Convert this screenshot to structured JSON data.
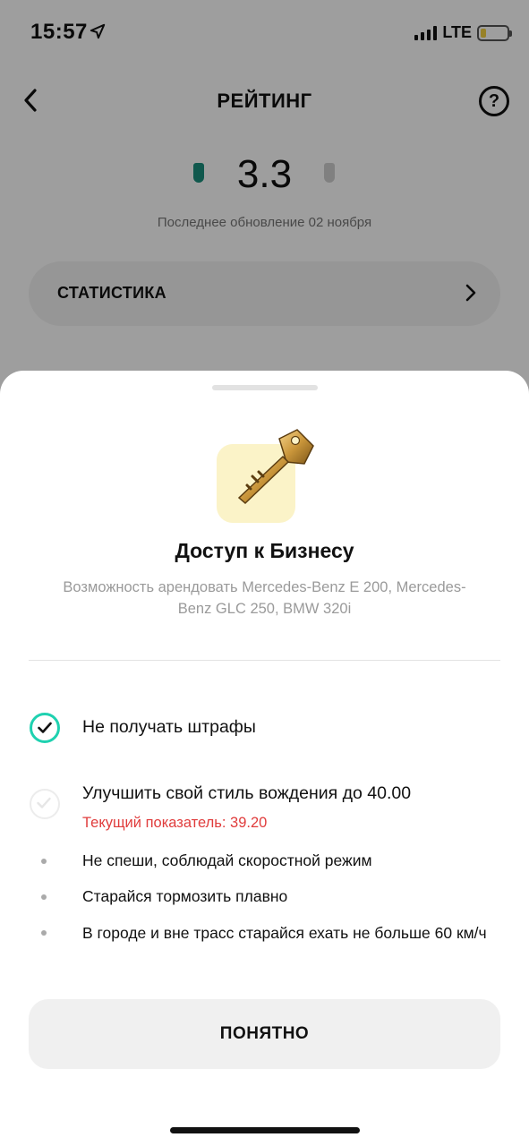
{
  "status_bar": {
    "time": "15:57",
    "network": "LTE",
    "battery_level": 0.2,
    "signal_bars": 4
  },
  "nav": {
    "title": "РЕЙТИНГ",
    "help_label": "?"
  },
  "rating": {
    "value": "3.3",
    "updated": "Последнее обновление 02 ноября"
  },
  "stats": {
    "label": "СТАТИСТИКА"
  },
  "sheet": {
    "title": "Доступ к Бизнесу",
    "subtitle": "Возможность арендовать Mercedes-Benz E 200, Mercedes-Benz GLC 250, BMW 320i",
    "requirements": [
      {
        "label": "Не получать штрафы",
        "done": true
      },
      {
        "label": "Улучшить свой стиль вождения до 40.00",
        "done": false,
        "current": "Текущий показатель: 39.20"
      }
    ],
    "tips": [
      "Не спеши, соблюдай скоростной режим",
      "Старайся тормозить плавно",
      "В городе и вне трасс старайся ехать не больше 60 км/ч"
    ],
    "button": "ПОНЯТНО"
  },
  "colors": {
    "accent_green": "#1fd1b0",
    "warning_red": "#e03c3c",
    "key_tile": "#fbf3c8"
  },
  "icons": {
    "back": "chevron-left-icon",
    "help": "question-circle-icon",
    "stats": "chevron-right-icon",
    "key": "key-icon",
    "check": "checkmark-icon"
  }
}
